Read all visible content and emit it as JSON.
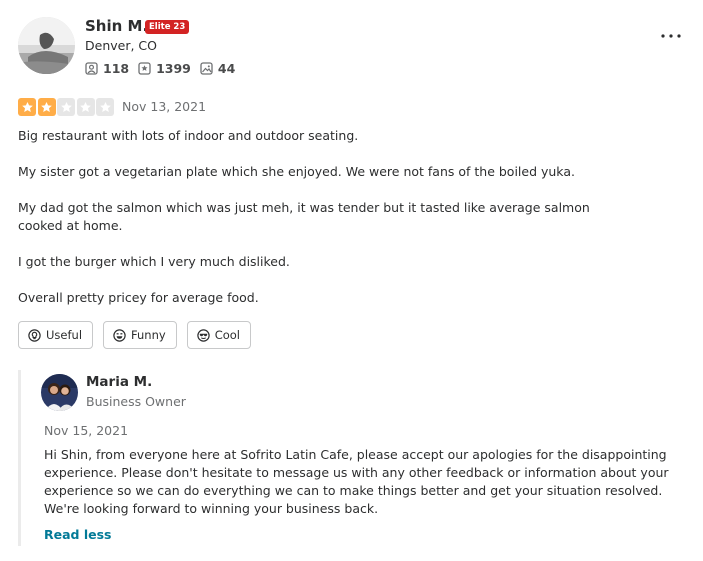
{
  "reviewer": {
    "name": "Shin M.",
    "elite_badge": "Elite 23",
    "location": "Denver, CO",
    "stats": {
      "friends": "118",
      "reviews": "1399",
      "photos": "44"
    }
  },
  "review": {
    "rating": 2,
    "max_rating": 5,
    "star_filled_color": "#ffad48",
    "star_empty_color": "#e6e6e6",
    "date": "Nov 13, 2021",
    "paragraphs": [
      "Big restaurant with lots of indoor and outdoor seating.",
      "My sister got a vegetarian plate which she enjoyed. We were not fans of the boiled yuka.",
      "My dad got the salmon which was just meh, it was tender but it tasted like average salmon cooked at home.",
      "I got the burger which I very much disliked.",
      "Overall pretty pricey for average food."
    ]
  },
  "reactions": {
    "useful": "Useful",
    "funny": "Funny",
    "cool": "Cool"
  },
  "owner_reply": {
    "name": "Maria M.",
    "role": "Business Owner",
    "date": "Nov 15, 2021",
    "text": "Hi Shin, from everyone here at Sofrito Latin Cafe, please accept our apologies for the disappointing experience. Please don't hesitate to message us with any other feedback or information about your experience so we can do everything we can to make things better and get your situation resolved. We're looking forward to winning your business back.",
    "read_less": "Read less"
  },
  "colors": {
    "elite": "#d32323",
    "link": "#027a97"
  }
}
